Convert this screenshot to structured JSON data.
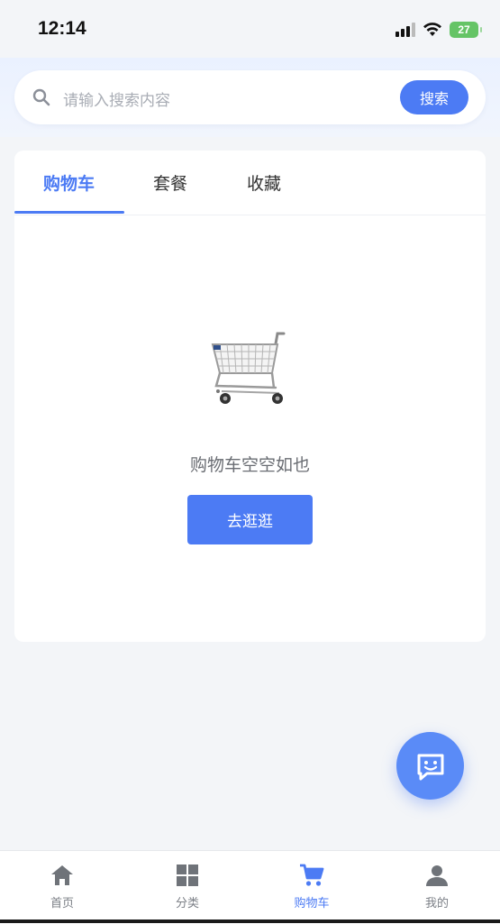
{
  "status_bar": {
    "time": "12:14",
    "battery": "27",
    "icons": [
      "signal-icon",
      "wifi-icon",
      "battery-icon"
    ]
  },
  "search": {
    "placeholder": "请输入搜索内容",
    "button_label": "搜索",
    "icon": "search-icon"
  },
  "tabs": [
    {
      "label": "购物车",
      "active": true
    },
    {
      "label": "套餐",
      "active": false
    },
    {
      "label": "收藏",
      "active": false
    }
  ],
  "empty_state": {
    "icon": "shopping-cart-illustration",
    "message": "购物车空空如也",
    "button_label": "去逛逛"
  },
  "floating_button": {
    "icon": "chat-icon"
  },
  "bottom_nav": [
    {
      "label": "首页",
      "icon": "home-icon",
      "active": false
    },
    {
      "label": "分类",
      "icon": "category-grid-icon",
      "active": false
    },
    {
      "label": "购物车",
      "icon": "cart-icon",
      "active": true
    },
    {
      "label": "我的",
      "icon": "user-icon",
      "active": false
    }
  ],
  "colors": {
    "accent": "#4c7bf4",
    "background": "#f3f5f8",
    "text_muted": "#7b7f86"
  }
}
